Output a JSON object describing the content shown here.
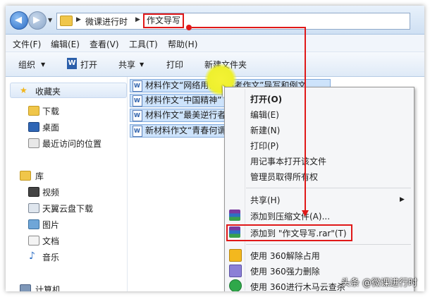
{
  "address": {
    "crumbs": [
      "微课进行时",
      "作文导写"
    ]
  },
  "menubar": [
    "文件(F)",
    "编辑(E)",
    "查看(V)",
    "工具(T)",
    "帮助(H)"
  ],
  "toolbar": {
    "organize": "组织",
    "open": "打开",
    "share": "共享",
    "print": "打印",
    "new_folder": "新建文件夹"
  },
  "nav": {
    "favorites": "收藏夹",
    "downloads": "下载",
    "desktop": "桌面",
    "recent": "最近访问的位置",
    "libraries": "库",
    "video": "视频",
    "tianyi": "天翼云盘下载",
    "pictures": "图片",
    "documents": "文档",
    "music": "音乐",
    "computer": "计算机"
  },
  "files": [
    "材料作文“网络用语与高考作文”导写和例文",
    "材料作文“中国精神”",
    "材料作文“最美逆行者”",
    "新材料作文“青春何谓”"
  ],
  "context_menu": {
    "open": "打开(O)",
    "edit": "编辑(E)",
    "new": "新建(N)",
    "print": "打印(P)",
    "notepad": "用记事本打开该文件",
    "admin": "管理员取得所有权",
    "share": "共享(H)",
    "add_archive": "添加到压缩文件(A)...",
    "add_to_rar": "添加到 \"作文导写.rar\"(T)",
    "unlock360": "使用 360解除占用",
    "delete360": "使用 360强力删除",
    "scan360": "使用 360进行木马云查杀"
  },
  "watermark": "头条 @微课进行时"
}
